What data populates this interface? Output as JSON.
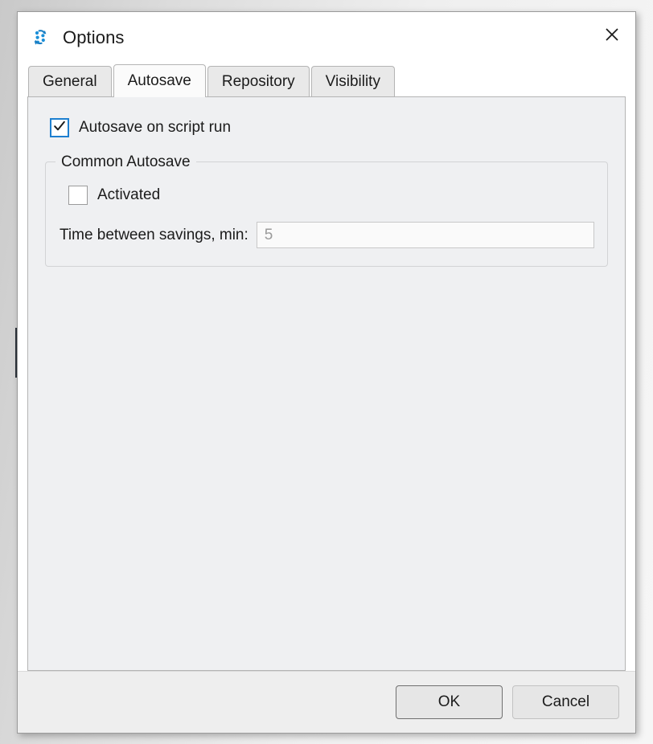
{
  "window": {
    "title": "Options",
    "icon": "options-cycle-icon",
    "close_icon": "close-icon"
  },
  "tabs": [
    {
      "label": "General",
      "selected": false
    },
    {
      "label": "Autosave",
      "selected": true
    },
    {
      "label": "Repository",
      "selected": false
    },
    {
      "label": "Visibility",
      "selected": false
    }
  ],
  "autosave_panel": {
    "autosave_on_script_run": {
      "label": "Autosave on script run",
      "checked": true
    },
    "group": {
      "legend": "Common Autosave",
      "activated": {
        "label": "Activated",
        "checked": false
      },
      "time_between_savings": {
        "label": "Time between savings, min:",
        "value": "5",
        "placeholder": "5"
      }
    }
  },
  "footer": {
    "ok_label": "OK",
    "cancel_label": "Cancel"
  },
  "colors": {
    "accent": "#1d7fd0",
    "window_bg": "#ffffff",
    "panel_bg": "#eff0f2",
    "footer_bg": "#eeeeee",
    "border": "#b4b4b4",
    "text": "#1b1b1b",
    "disabled_text": "#9a9a9a"
  }
}
